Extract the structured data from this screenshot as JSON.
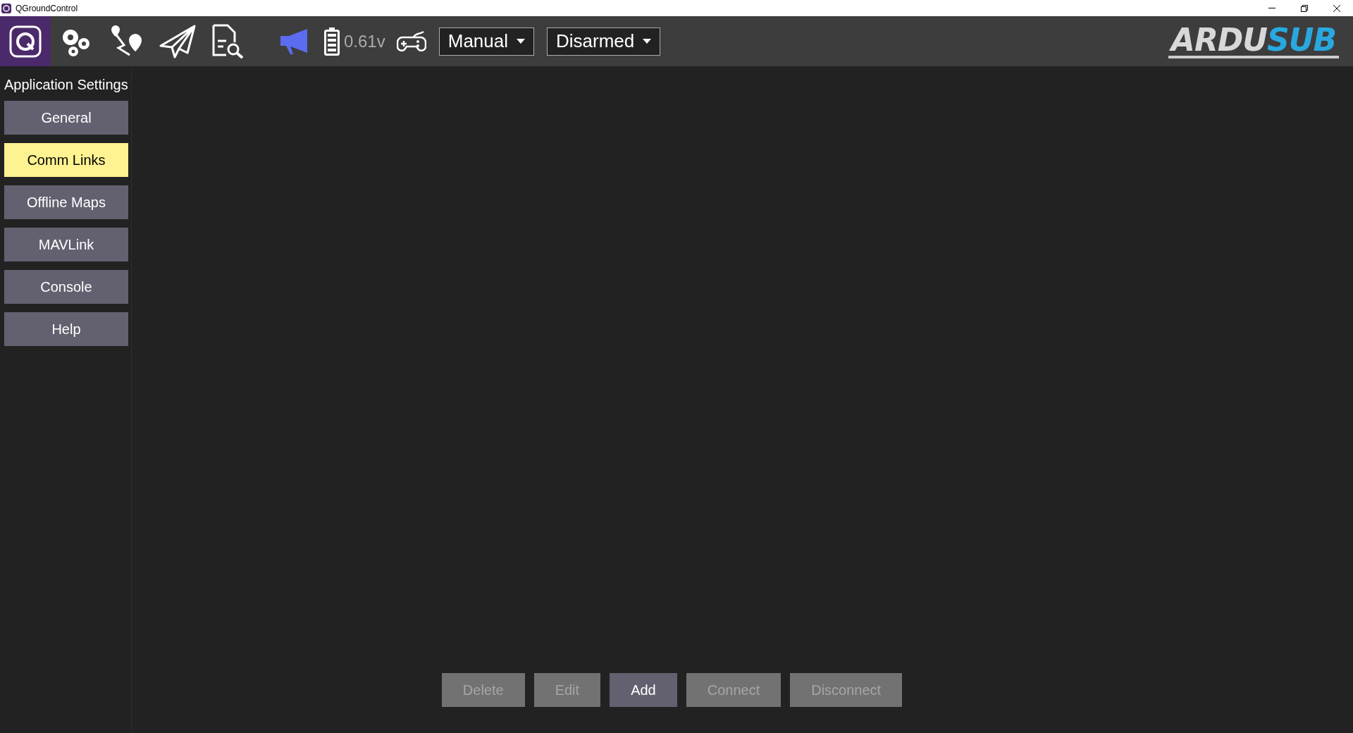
{
  "window": {
    "title": "QGroundControl"
  },
  "toolbar": {
    "battery": "0.61v",
    "flight_mode": "Manual",
    "arm_state": "Disarmed",
    "logo": {
      "text": "ARDU",
      "accent": "SUB"
    }
  },
  "sidebar": {
    "title": "Application Settings",
    "items": [
      {
        "label": "General",
        "selected": false
      },
      {
        "label": "Comm Links",
        "selected": true
      },
      {
        "label": "Offline Maps",
        "selected": false
      },
      {
        "label": "MAVLink",
        "selected": false
      },
      {
        "label": "Console",
        "selected": false
      },
      {
        "label": "Help",
        "selected": false
      }
    ]
  },
  "buttons": [
    {
      "label": "Delete",
      "disabled": true
    },
    {
      "label": "Edit",
      "disabled": true
    },
    {
      "label": "Add",
      "disabled": false
    },
    {
      "label": "Connect",
      "disabled": true
    },
    {
      "label": "Disconnect",
      "disabled": true
    }
  ]
}
